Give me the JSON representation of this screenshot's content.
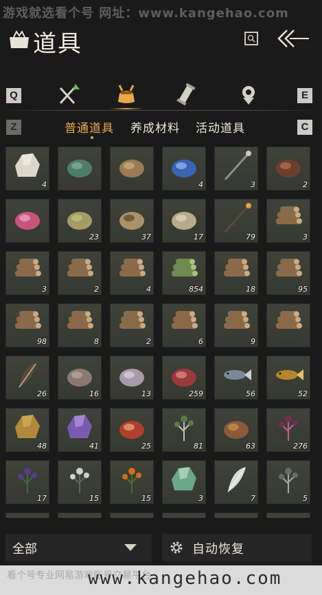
{
  "watermark": {
    "top_text": "游戏就选看个号   网址：www.kangehao.com",
    "bottom_cn": "看个号专业网易游戏账号交易平台",
    "bottom_url": "www.kangehao.com"
  },
  "header": {
    "title": "道具",
    "icons": [
      "bag-icon",
      "search-icon",
      "back-arrow-icon"
    ]
  },
  "category_bar": {
    "left_key": "Q",
    "right_key": "E",
    "categories": [
      {
        "icon": "weapons-icon",
        "active": false
      },
      {
        "icon": "pouch-icon",
        "active": true
      },
      {
        "icon": "scroll-icon",
        "active": false
      },
      {
        "icon": "token-icon",
        "active": false
      }
    ]
  },
  "subtabs": {
    "left_key": "Z",
    "right_key": "C",
    "items": [
      {
        "label": "普通道具",
        "active": true
      },
      {
        "label": "养成材料",
        "active": false
      },
      {
        "label": "活动道具",
        "active": false
      }
    ]
  },
  "items": [
    {
      "icon": "crystal-cluster-icon",
      "count": "4"
    },
    {
      "icon": "book-icon",
      "count": ""
    },
    {
      "icon": "bamboo-scroll-icon",
      "count": ""
    },
    {
      "icon": "blue-pouch-icon",
      "count": "4"
    },
    {
      "icon": "staff-icon",
      "count": "3"
    },
    {
      "icon": "wooden-box-icon",
      "count": "2"
    },
    {
      "icon": "kite-icon",
      "count": ""
    },
    {
      "icon": "herb-powder-icon",
      "count": "23"
    },
    {
      "icon": "worm-icon",
      "count": "37"
    },
    {
      "icon": "sack-icon",
      "count": "17"
    },
    {
      "icon": "arrow-icon",
      "count": "79"
    },
    {
      "icon": "logs-icon",
      "count": "3"
    },
    {
      "icon": "logs-icon",
      "count": "3"
    },
    {
      "icon": "logs-icon",
      "count": "2"
    },
    {
      "icon": "logs-icon",
      "count": "4"
    },
    {
      "icon": "bamboo-logs-icon",
      "count": "854"
    },
    {
      "icon": "logs-icon",
      "count": "18"
    },
    {
      "icon": "logs-icon",
      "count": "95"
    },
    {
      "icon": "logs-icon",
      "count": "98"
    },
    {
      "icon": "logs-icon",
      "count": "8"
    },
    {
      "icon": "logs-icon",
      "count": "2"
    },
    {
      "icon": "logs-icon",
      "count": "6"
    },
    {
      "icon": "logs-icon",
      "count": "9"
    },
    {
      "icon": "logs-icon",
      "count": ""
    },
    {
      "icon": "feather-icon",
      "count": "26"
    },
    {
      "icon": "hide-icon",
      "count": "16"
    },
    {
      "icon": "cloth-icon",
      "count": "13"
    },
    {
      "icon": "meat-icon",
      "count": "259"
    },
    {
      "icon": "fish-icon",
      "count": "56"
    },
    {
      "icon": "golden-fish-icon",
      "count": "52"
    },
    {
      "icon": "ore-icon",
      "count": "48"
    },
    {
      "icon": "amethyst-icon",
      "count": "41"
    },
    {
      "icon": "chestnut-icon",
      "count": "25"
    },
    {
      "icon": "herb-icon",
      "count": "81"
    },
    {
      "icon": "mortar-icon",
      "count": "63"
    },
    {
      "icon": "purple-flower-icon",
      "count": "276"
    },
    {
      "icon": "lavender-icon",
      "count": "17"
    },
    {
      "icon": "white-flower-icon",
      "count": "15"
    },
    {
      "icon": "orange-flower-icon",
      "count": "15"
    },
    {
      "icon": "jade-icon",
      "count": "3"
    },
    {
      "icon": "white-feather-icon",
      "count": "7"
    },
    {
      "icon": "grass-icon",
      "count": "5"
    }
  ],
  "footer": {
    "filter_label": "全部",
    "auto_restore_label": "自动恢复"
  },
  "colors": {
    "accent": "#e7a94a",
    "background": "#1a1a1a",
    "cell": "#3b3f36"
  }
}
